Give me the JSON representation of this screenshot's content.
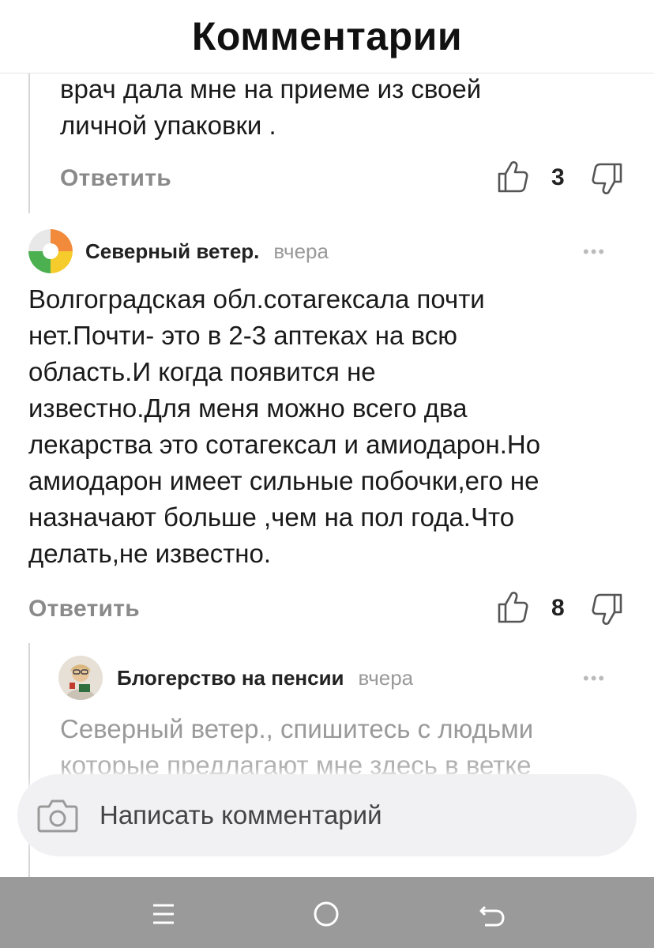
{
  "header": {
    "title": "Комментарии"
  },
  "comments": [
    {
      "text_lines": [
        "врач  дала мне  на приеме из своей",
        "личной упаковки ."
      ],
      "reply_label": "Ответить",
      "likes": "3"
    },
    {
      "author": "Северный ветер.",
      "date": "вчера",
      "text_lines": [
        "Волгоградская обл.сотагексала почти",
        "нет.Почти- это в 2-3 аптеках на всю",
        "область.И когда появится не",
        "известно.Для меня можно всего два",
        "лекарства это сотагексал и амиодарон.Но",
        "амиодарон имеет сильные побочки,его не",
        "назначают больше ,чем на пол года.Что",
        "делать,не известно."
      ],
      "reply_label": "Ответить",
      "likes": "8",
      "menu": "•••"
    },
    {
      "author": "Блогерство на пенсии",
      "date": "вчера",
      "text_lines": [
        "Северный ветер., спишитесь с людьми",
        "которые предлагают мне здесь в ветке"
      ],
      "menu": "•••"
    }
  ],
  "composer": {
    "placeholder": "Написать комментарий",
    "icon": "camera-icon"
  },
  "navbar": {
    "icons": [
      "menu-icon",
      "home-icon",
      "back-icon"
    ]
  },
  "colors": {
    "background": "#ffffff",
    "navbar": "#9a9a9a",
    "composer_bg": "#f1f1f4",
    "muted": "#8a8a8a"
  }
}
